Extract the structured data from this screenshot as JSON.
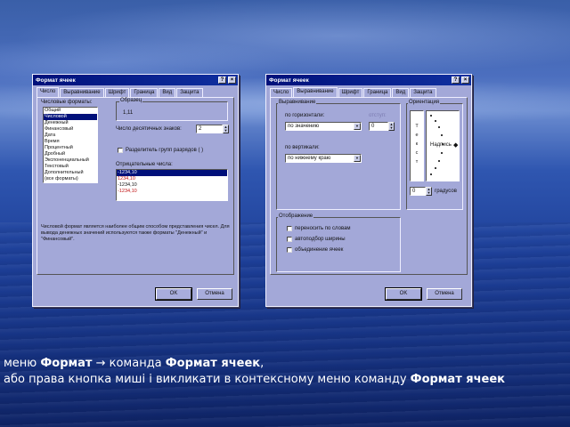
{
  "dialog1": {
    "title": "Формат ячеек",
    "help": "?",
    "close": "×",
    "tabs": [
      "Число",
      "Выравнивание",
      "Шрифт",
      "Граница",
      "Вид",
      "Защита"
    ],
    "formats_label": "Числовые форматы:",
    "formats": [
      "Общий",
      "Числовой",
      "Денежный",
      "Финансовый",
      "Дата",
      "Время",
      "Процентный",
      "Дробный",
      "Экспоненциальный",
      "Текстовый",
      "Дополнительный",
      "(все форматы)"
    ],
    "selected_format_index": 1,
    "sample_label": "Образец",
    "sample_value": "1,11",
    "decimals_label": "Число десятичных знаков:",
    "decimals_value": "2",
    "separator_label": "Разделитель групп разрядов ( )",
    "negative_label": "Отрицательные числа:",
    "negatives": [
      {
        "text": "-1234,10",
        "red": false
      },
      {
        "text": "1234,10",
        "red": true
      },
      {
        "text": "-1234,10",
        "red": false
      },
      {
        "text": "-1234,10",
        "red": true
      }
    ],
    "description": "Числовой формат является наиболее общим способом представления чисел. Для вывода денежных значений используются также форматы \"Денежный\" и \"Финансовый\".",
    "ok": "OK",
    "cancel": "Отмена"
  },
  "dialog2": {
    "title": "Формат ячеек",
    "help": "?",
    "close": "×",
    "tabs": [
      "Число",
      "Выравнивание",
      "Шрифт",
      "Граница",
      "Вид",
      "Защита"
    ],
    "align_group": "Выравнивание",
    "horizontal_label": "по горизонтали:",
    "horizontal_value": "по значению",
    "indent_label": "отступ:",
    "indent_value": "0",
    "vertical_label": "по вертикали:",
    "vertical_value": "по нижнему краю",
    "orientation_label": "Ориентация",
    "vertical_text": [
      "Т",
      "е",
      "к",
      "с",
      "т"
    ],
    "orientation_caption": "Надпись",
    "degrees_value": "0",
    "degrees_label": "градусов",
    "display_group": "Отображение",
    "wrap_label": "переносить по словам",
    "autofit_label": "автоподбор ширины",
    "merge_label": "объединение ячеек",
    "ok": "OK",
    "cancel": "Отмена"
  },
  "caption": {
    "line1_pre": "меню ",
    "line1_b1": "Формат",
    "line1_arrow": " → команда ",
    "line1_b2": "Формат ячеек",
    "line1_end": ",",
    "line2_pre": "або права кнопка миші і викликати в контексному меню команду ",
    "line2_b": "Формат ячеек"
  }
}
